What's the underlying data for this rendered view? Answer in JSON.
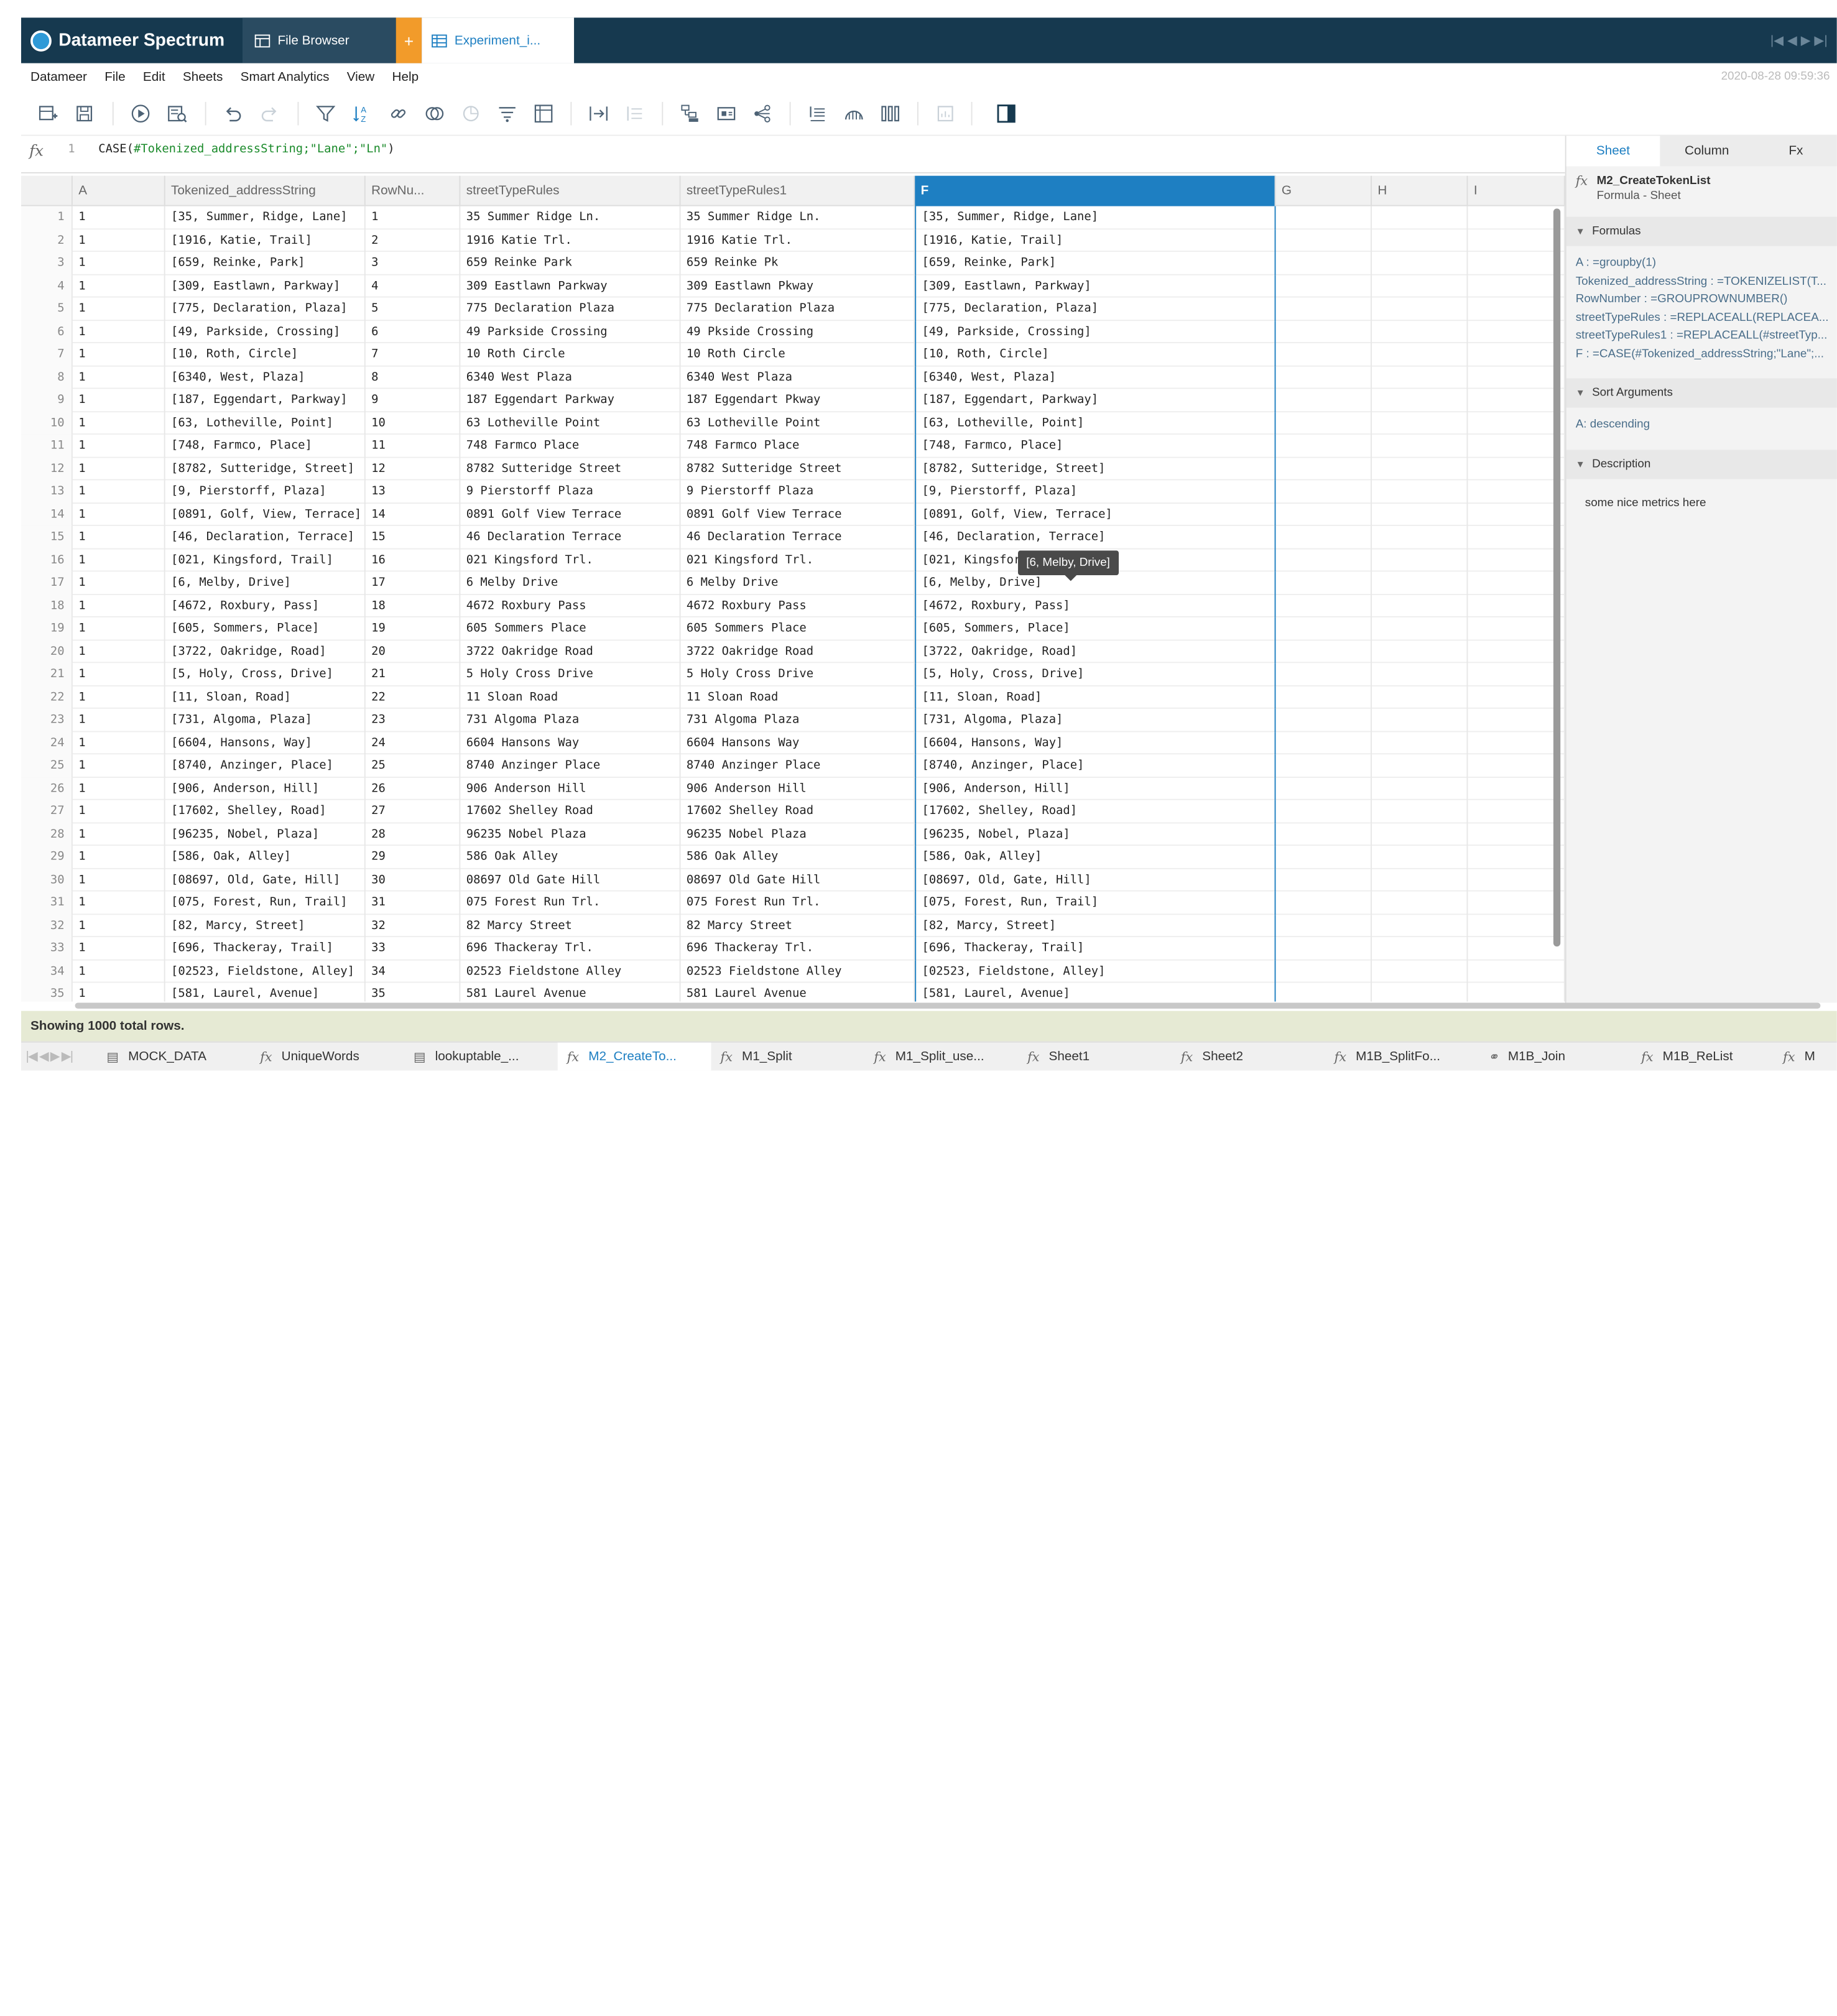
{
  "app": {
    "name": "Datameer Spectrum",
    "tabs": [
      {
        "label": "File Browser",
        "icon": "file-browser-icon"
      },
      {
        "label": "+",
        "icon": "plus-icon"
      },
      {
        "label": "Experiment_i...",
        "icon": "table-icon"
      }
    ],
    "window_controls": "|◀ ◀ ▶ ▶|"
  },
  "menu": {
    "items": [
      "Datameer",
      "File",
      "Edit",
      "Sheets",
      "Smart Analytics",
      "View",
      "Help"
    ],
    "datetime": "2020-08-28 09:59:36"
  },
  "toolbar": {
    "icons": [
      "new-sheet-icon",
      "save-icon",
      "run-icon",
      "preview-icon",
      "undo-icon",
      "redo-icon",
      "filter-icon",
      "sort-icon",
      "link-icon",
      "join-icon",
      "union-icon",
      "group-icon",
      "pivot-icon",
      "split-icon",
      "merge-icon",
      "hierarchy-icon",
      "copy-format-icon",
      "share-icon",
      "align-icon",
      "chart-icon",
      "columns-icon",
      "insert-icon",
      "panel-toggle-icon"
    ]
  },
  "formula": {
    "fx": "fx",
    "line": "1",
    "prefix": "CASE(",
    "arg": "#Tokenized_addressString;\"Lane\";\"Ln\"",
    "suffix": ")"
  },
  "grid": {
    "columns": [
      "A",
      "Tokenized_addressString",
      "RowNu...",
      "streetTypeRules",
      "streetTypeRules1",
      "F",
      "G",
      "H",
      "I"
    ],
    "rows": [
      [
        "1",
        "1",
        "[35, Summer, Ridge, Lane]",
        "1",
        "35 Summer Ridge Ln.",
        "35 Summer Ridge Ln.",
        "[35, Summer, Ridge, Lane]"
      ],
      [
        "2",
        "1",
        "[1916, Katie, Trail]",
        "2",
        "1916 Katie Trl.",
        "1916 Katie Trl.",
        "[1916, Katie, Trail]"
      ],
      [
        "3",
        "1",
        "[659, Reinke, Park]",
        "3",
        "659 Reinke Park",
        "659 Reinke Pk",
        "[659, Reinke, Park]"
      ],
      [
        "4",
        "1",
        "[309, Eastlawn, Parkway]",
        "4",
        "309 Eastlawn Parkway",
        "309 Eastlawn Pkway",
        "[309, Eastlawn, Parkway]"
      ],
      [
        "5",
        "1",
        "[775, Declaration, Plaza]",
        "5",
        "775 Declaration Plaza",
        "775 Declaration Plaza",
        "[775, Declaration, Plaza]"
      ],
      [
        "6",
        "1",
        "[49, Parkside, Crossing]",
        "6",
        "49 Parkside Crossing",
        "49 Pkside Crossing",
        "[49, Parkside, Crossing]"
      ],
      [
        "7",
        "1",
        "[10, Roth, Circle]",
        "7",
        "10 Roth Circle",
        "10 Roth Circle",
        "[10, Roth, Circle]"
      ],
      [
        "8",
        "1",
        "[6340, West, Plaza]",
        "8",
        "6340 West Plaza",
        "6340 West Plaza",
        "[6340, West, Plaza]"
      ],
      [
        "9",
        "1",
        "[187, Eggendart, Parkway]",
        "9",
        "187 Eggendart Parkway",
        "187 Eggendart Pkway",
        "[187, Eggendart, Parkway]"
      ],
      [
        "10",
        "1",
        "[63, Lotheville, Point]",
        "10",
        "63 Lotheville Point",
        "63 Lotheville Point",
        "[63, Lotheville, Point]"
      ],
      [
        "11",
        "1",
        "[748, Farmco, Place]",
        "11",
        "748 Farmco Place",
        "748 Farmco Place",
        "[748, Farmco, Place]"
      ],
      [
        "12",
        "1",
        "[8782, Sutteridge, Street]",
        "12",
        "8782 Sutteridge Street",
        "8782 Sutteridge Street",
        "[8782, Sutteridge, Street]"
      ],
      [
        "13",
        "1",
        "[9, Pierstorff, Plaza]",
        "13",
        "9 Pierstorff Plaza",
        "9 Pierstorff Plaza",
        "[9, Pierstorff, Plaza]"
      ],
      [
        "14",
        "1",
        "[0891, Golf, View, Terrace]",
        "14",
        "0891 Golf View Terrace",
        "0891 Golf View Terrace",
        "[0891, Golf, View, Terrace]"
      ],
      [
        "15",
        "1",
        "[46, Declaration, Terrace]",
        "15",
        "46 Declaration Terrace",
        "46 Declaration Terrace",
        "[46, Declaration, Terrace]"
      ],
      [
        "16",
        "1",
        "[021, Kingsford, Trail]",
        "16",
        "021 Kingsford Trl.",
        "021 Kingsford Trl.",
        "[021, Kingsford, Trail]"
      ],
      [
        "17",
        "1",
        "[6, Melby, Drive]",
        "17",
        "6 Melby Drive",
        "6 Melby Drive",
        "[6, Melby, Drive]"
      ],
      [
        "18",
        "1",
        "[4672, Roxbury, Pass]",
        "18",
        "4672 Roxbury Pass",
        "4672 Roxbury Pass",
        "[4672, Roxbury, Pass]"
      ],
      [
        "19",
        "1",
        "[605, Sommers, Place]",
        "19",
        "605 Sommers Place",
        "605 Sommers Place",
        "[605, Sommers, Place]"
      ],
      [
        "20",
        "1",
        "[3722, Oakridge, Road]",
        "20",
        "3722 Oakridge Road",
        "3722 Oakridge Road",
        "[3722, Oakridge, Road]"
      ],
      [
        "21",
        "1",
        "[5, Holy, Cross, Drive]",
        "21",
        "5 Holy Cross Drive",
        "5 Holy Cross Drive",
        "[5, Holy, Cross, Drive]"
      ],
      [
        "22",
        "1",
        "[11, Sloan, Road]",
        "22",
        "11 Sloan Road",
        "11 Sloan Road",
        "[11, Sloan, Road]"
      ],
      [
        "23",
        "1",
        "[731, Algoma, Plaza]",
        "23",
        "731 Algoma Plaza",
        "731 Algoma Plaza",
        "[731, Algoma, Plaza]"
      ],
      [
        "24",
        "1",
        "[6604, Hansons, Way]",
        "24",
        "6604 Hansons Way",
        "6604 Hansons Way",
        "[6604, Hansons, Way]"
      ],
      [
        "25",
        "1",
        "[8740, Anzinger, Place]",
        "25",
        "8740 Anzinger Place",
        "8740 Anzinger Place",
        "[8740, Anzinger, Place]"
      ],
      [
        "26",
        "1",
        "[906, Anderson, Hill]",
        "26",
        "906 Anderson Hill",
        "906 Anderson Hill",
        "[906, Anderson, Hill]"
      ],
      [
        "27",
        "1",
        "[17602, Shelley, Road]",
        "27",
        "17602 Shelley Road",
        "17602 Shelley Road",
        "[17602, Shelley, Road]"
      ],
      [
        "28",
        "1",
        "[96235, Nobel, Plaza]",
        "28",
        "96235 Nobel Plaza",
        "96235 Nobel Plaza",
        "[96235, Nobel, Plaza]"
      ],
      [
        "29",
        "1",
        "[586, Oak, Alley]",
        "29",
        "586 Oak Alley",
        "586 Oak Alley",
        "[586, Oak, Alley]"
      ],
      [
        "30",
        "1",
        "[08697, Old, Gate, Hill]",
        "30",
        "08697 Old Gate Hill",
        "08697 Old Gate Hill",
        "[08697, Old, Gate, Hill]"
      ],
      [
        "31",
        "1",
        "[075, Forest, Run, Trail]",
        "31",
        "075 Forest Run Trl.",
        "075 Forest Run Trl.",
        "[075, Forest, Run, Trail]"
      ],
      [
        "32",
        "1",
        "[82, Marcy, Street]",
        "32",
        "82 Marcy Street",
        "82 Marcy Street",
        "[82, Marcy, Street]"
      ],
      [
        "33",
        "1",
        "[696, Thackeray, Trail]",
        "33",
        "696 Thackeray Trl.",
        "696 Thackeray Trl.",
        "[696, Thackeray, Trail]"
      ],
      [
        "34",
        "1",
        "[02523, Fieldstone, Alley]",
        "34",
        "02523 Fieldstone Alley",
        "02523 Fieldstone Alley",
        "[02523, Fieldstone, Alley]"
      ],
      [
        "35",
        "1",
        "[581, Laurel, Avenue]",
        "35",
        "581 Laurel Avenue",
        "581 Laurel Avenue",
        "[581, Laurel, Avenue]"
      ]
    ],
    "tooltip": "[6, Melby, Drive]",
    "sort_icon": "-Z A"
  },
  "panel": {
    "tabs": [
      "Sheet",
      "Column",
      "Fx"
    ],
    "sheet_name": "M2_CreateTokenList",
    "sheet_type": "Formula - Sheet",
    "fx": "fx",
    "formulas_title": "Formulas",
    "formulas": [
      "A : =groupby(1)",
      "Tokenized_addressString : =TOKENIZELIST(T...",
      "RowNumber : =GROUPROWNUMBER()",
      "streetTypeRules : =REPLACEALL(REPLACEA...",
      "streetTypeRules1 : =REPLACEALL(#streetTyp...",
      "F : =CASE(#Tokenized_addressString;\"Lane\";..."
    ],
    "sort_title": "Sort Arguments",
    "sort_args": "A: descending",
    "description_title": "Description",
    "description": "some nice metrics here"
  },
  "status": "Showing 1000 total rows.",
  "sheets": [
    {
      "label": "MOCK_DATA",
      "icon": "data-sheet-icon"
    },
    {
      "label": "UniqueWords",
      "icon": "fx-icon"
    },
    {
      "label": "lookuptable_...",
      "icon": "data-sheet-icon"
    },
    {
      "label": "M2_CreateTo...",
      "icon": "fx-icon"
    },
    {
      "label": "M1_Split",
      "icon": "fx-icon"
    },
    {
      "label": "M1_Split_use...",
      "icon": "fx-icon"
    },
    {
      "label": "Sheet1",
      "icon": "fx-icon"
    },
    {
      "label": "Sheet2",
      "icon": "fx-icon"
    },
    {
      "label": "M1B_SplitFo...",
      "icon": "fx-icon"
    },
    {
      "label": "M1B_Join",
      "icon": "link-icon"
    },
    {
      "label": "M1B_ReList",
      "icon": "fx-icon"
    },
    {
      "label": "M",
      "icon": "fx-icon"
    }
  ],
  "colors": {
    "accent": "#1e7fc2",
    "titlebar": "#16394f",
    "orange": "#f29b2a"
  }
}
